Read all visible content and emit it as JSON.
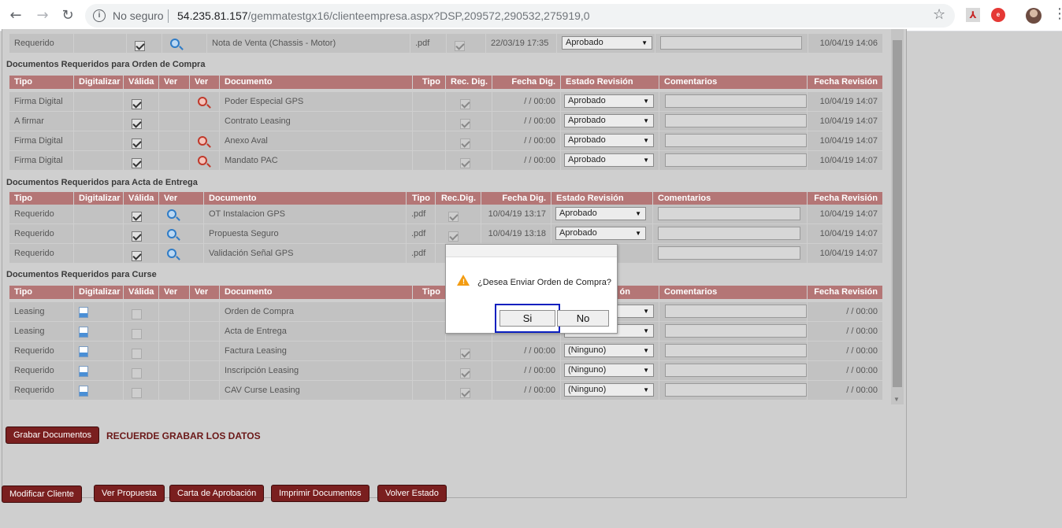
{
  "browser": {
    "insecure_label": "No seguro",
    "url_host": "54.235.81.157",
    "url_path": "/gemmatestgx16/clienteempresa.aspx?DSP,209572,290532,275919,0",
    "ext_red_label": "e"
  },
  "icons": {
    "back": "arrow-left-icon",
    "forward": "arrow-right-icon",
    "reload": "reload-icon",
    "info": "info-icon",
    "star": "star-icon",
    "pdf": "pdf-extension-icon",
    "extension": "red-extension-icon",
    "profile": "avatar",
    "menu": "kebab-menu-icon",
    "view_blue": "magnifier-blue-icon",
    "view_red": "magnifier-red-icon",
    "scan": "scanner-icon",
    "warning": "warning-icon"
  },
  "colors": {
    "header": "#b47676",
    "button": "#7a1f1f",
    "focus": "#0a1fbf"
  },
  "top_row": {
    "tipo": "Requerido",
    "validada": true,
    "documento": "Nota de Venta (Chassis - Motor)",
    "ext": ".pdf",
    "rec": true,
    "fecha": "22/03/19 17:35",
    "estado": "Aprobado",
    "fecha_rev": "10/04/19 14:06"
  },
  "oc": {
    "title": "Documentos Requeridos para Orden de Compra",
    "headers": {
      "tipo": "Tipo",
      "digitalizar": "Digitalizar",
      "valida": "Válida",
      "ver1": "Ver",
      "ver2": "Ver",
      "documento": "Documento",
      "ext": "Tipo",
      "rec": "Rec. Dig.",
      "fecha": "Fecha Dig.",
      "estado": "Estado Revisión",
      "comentarios": "Comentarios",
      "fecha_rev": "Fecha Revisión"
    },
    "rows": [
      {
        "tipo": "Firma Digital",
        "icon": true,
        "documento": "Poder Especial GPS",
        "fecha": "/ / 00:00",
        "estado": "Aprobado",
        "fecha_rev": "10/04/19 14:07"
      },
      {
        "tipo": "A firmar",
        "icon": false,
        "documento": "Contrato Leasing",
        "fecha": "/ / 00:00",
        "estado": "Aprobado",
        "fecha_rev": "10/04/19 14:07"
      },
      {
        "tipo": "Firma Digital",
        "icon": true,
        "documento": "Anexo Aval",
        "fecha": "/ / 00:00",
        "estado": "Aprobado",
        "fecha_rev": "10/04/19 14:07"
      },
      {
        "tipo": "Firma Digital",
        "icon": true,
        "documento": "Mandato PAC",
        "fecha": "/ / 00:00",
        "estado": "Aprobado",
        "fecha_rev": "10/04/19 14:07"
      }
    ]
  },
  "ae": {
    "title": "Documentos Requeridos para Acta de Entrega",
    "headers": {
      "tipo": "Tipo",
      "digitalizar": "Digitalizar",
      "valida": "Válida",
      "ver": "Ver",
      "documento": "Documento",
      "ext": "Tipo",
      "rec": "Rec.Dig.",
      "fecha": "Fecha Dig.",
      "estado": "Estado Revisión",
      "comentarios": "Comentarios",
      "fecha_rev": "Fecha Revisión"
    },
    "rows": [
      {
        "tipo": "Requerido",
        "documento": "OT Instalacion GPS",
        "ext": ".pdf",
        "fecha": "10/04/19 13:17",
        "estado": "Aprobado",
        "fecha_rev": "10/04/19 14:07"
      },
      {
        "tipo": "Requerido",
        "documento": "Propuesta Seguro",
        "ext": ".pdf",
        "fecha": "10/04/19 13:18",
        "estado": "Aprobado",
        "fecha_rev": "10/04/19 14:07"
      },
      {
        "tipo": "Requerido",
        "documento": "Validación Señal GPS",
        "ext": ".pdf",
        "fecha": "",
        "estado": "",
        "fecha_rev": "10/04/19 14:07"
      }
    ]
  },
  "cu": {
    "title": "Documentos Requeridos para Curse",
    "headers": {
      "tipo": "Tipo",
      "digitalizar": "Digitalizar",
      "valida": "Válida",
      "ver1": "Ver",
      "ver2": "Ver",
      "documento": "Documento",
      "ext": "Tipo",
      "estado_tail": "ón",
      "comentarios": "Comentarios",
      "fecha_rev": "Fecha Revisión"
    },
    "rows": [
      {
        "tipo": "Leasing",
        "documento": "Orden de Compra",
        "rec": false,
        "fecha": "",
        "estado": "",
        "fecha_rev": "/ / 00:00"
      },
      {
        "tipo": "Leasing",
        "documento": "Acta de Entrega",
        "rec": false,
        "fecha": "",
        "estado": "",
        "fecha_rev": "/ / 00:00"
      },
      {
        "tipo": "Requerido",
        "documento": "Factura Leasing",
        "rec": true,
        "fecha": "/ / 00:00",
        "estado": "(Ninguno)",
        "fecha_rev": "/ / 00:00"
      },
      {
        "tipo": "Requerido",
        "documento": "Inscripción Leasing",
        "rec": true,
        "fecha": "/ / 00:00",
        "estado": "(Ninguno)",
        "fecha_rev": "/ / 00:00"
      },
      {
        "tipo": "Requerido",
        "documento": "CAV Curse Leasing",
        "rec": true,
        "fecha": "/ / 00:00",
        "estado": "(Ninguno)",
        "fecha_rev": "/ / 00:00"
      }
    ]
  },
  "actions": {
    "grabar": "Grabar Documentos",
    "recuerde": "RECUERDE GRABAR LOS DATOS",
    "modificar": "Modificar Cliente",
    "ver_propuesta": "Ver Propuesta",
    "carta": "Carta de Aprobación",
    "imprimir": "Imprimir Documentos",
    "volver": "Volver Estado"
  },
  "dialog": {
    "message": "¿Desea Enviar Orden de Compra?",
    "yes": "Si",
    "no": "No"
  }
}
